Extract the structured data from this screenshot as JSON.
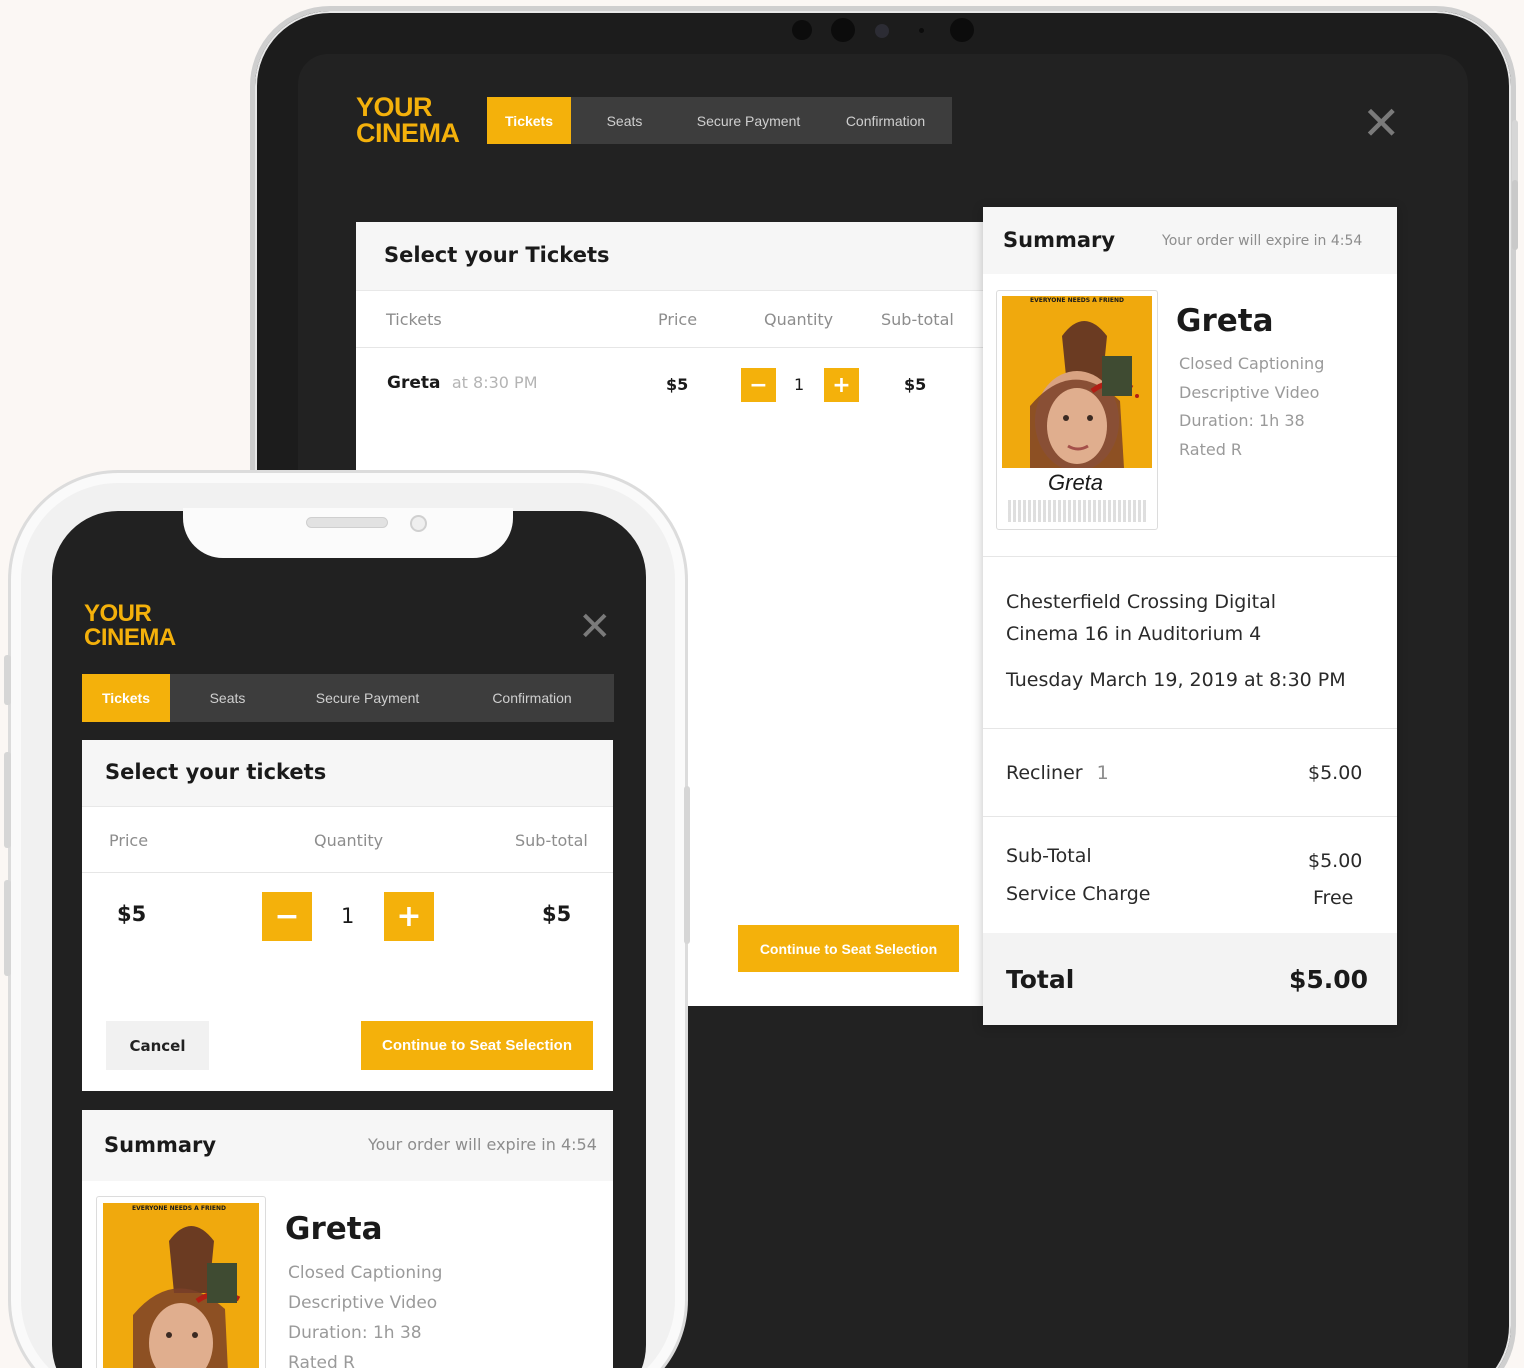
{
  "brand": {
    "logo_line1": "YOUR",
    "logo_line2": "CINEMA",
    "accent": "#f4b10b"
  },
  "steps": [
    "Tickets",
    "Seats",
    "Secure Payment",
    "Confirmation"
  ],
  "tablet": {
    "tickets_panel": {
      "title": "Select your Tickets",
      "columns": {
        "tickets": "Tickets",
        "price": "Price",
        "quantity": "Quantity",
        "subtotal": "Sub-total"
      },
      "row": {
        "movie": "Greta",
        "time": "at 8:30 PM",
        "price": "$5",
        "qty": "1",
        "subtotal": "$5"
      },
      "continue_label": "Continue to Seat Selection"
    },
    "summary": {
      "title": "Summary",
      "expire": "Your order will expire in 4:54",
      "movie_title": "Greta",
      "features": [
        "Closed Captioning",
        "Descriptive Video",
        "Duration: 1h 38",
        "Rated R"
      ],
      "venue_line1": "Chesterfield Crossing Digital",
      "venue_line2": "Cinema 16 in Auditorium 4",
      "datetime": "Tuesday March 19, 2019 at 8:30 PM",
      "seat_type": "Recliner",
      "seat_count": "1",
      "seat_price": "$5.00",
      "subtotal_label": "Sub-Total",
      "subtotal_value": "$5.00",
      "service_label": "Service Charge",
      "service_value": "Free",
      "total_label": "Total",
      "total_value": "$5.00"
    }
  },
  "phone": {
    "tickets_panel": {
      "title": "Select your tickets",
      "columns": {
        "price": "Price",
        "quantity": "Quantity",
        "subtotal": "Sub-total"
      },
      "row": {
        "price": "$5",
        "qty": "1",
        "subtotal": "$5"
      },
      "cancel_label": "Cancel",
      "continue_label": "Continue to Seat Selection"
    },
    "summary": {
      "title": "Summary",
      "expire": "Your order will expire in 4:54",
      "movie_title": "Greta",
      "features": [
        "Closed Captioning",
        "Descriptive Video",
        "Duration: 1h 38",
        "Rated R"
      ]
    }
  },
  "poster": {
    "tagline": "EVERYONE NEEDS A FRIEND",
    "title": "Greta"
  }
}
